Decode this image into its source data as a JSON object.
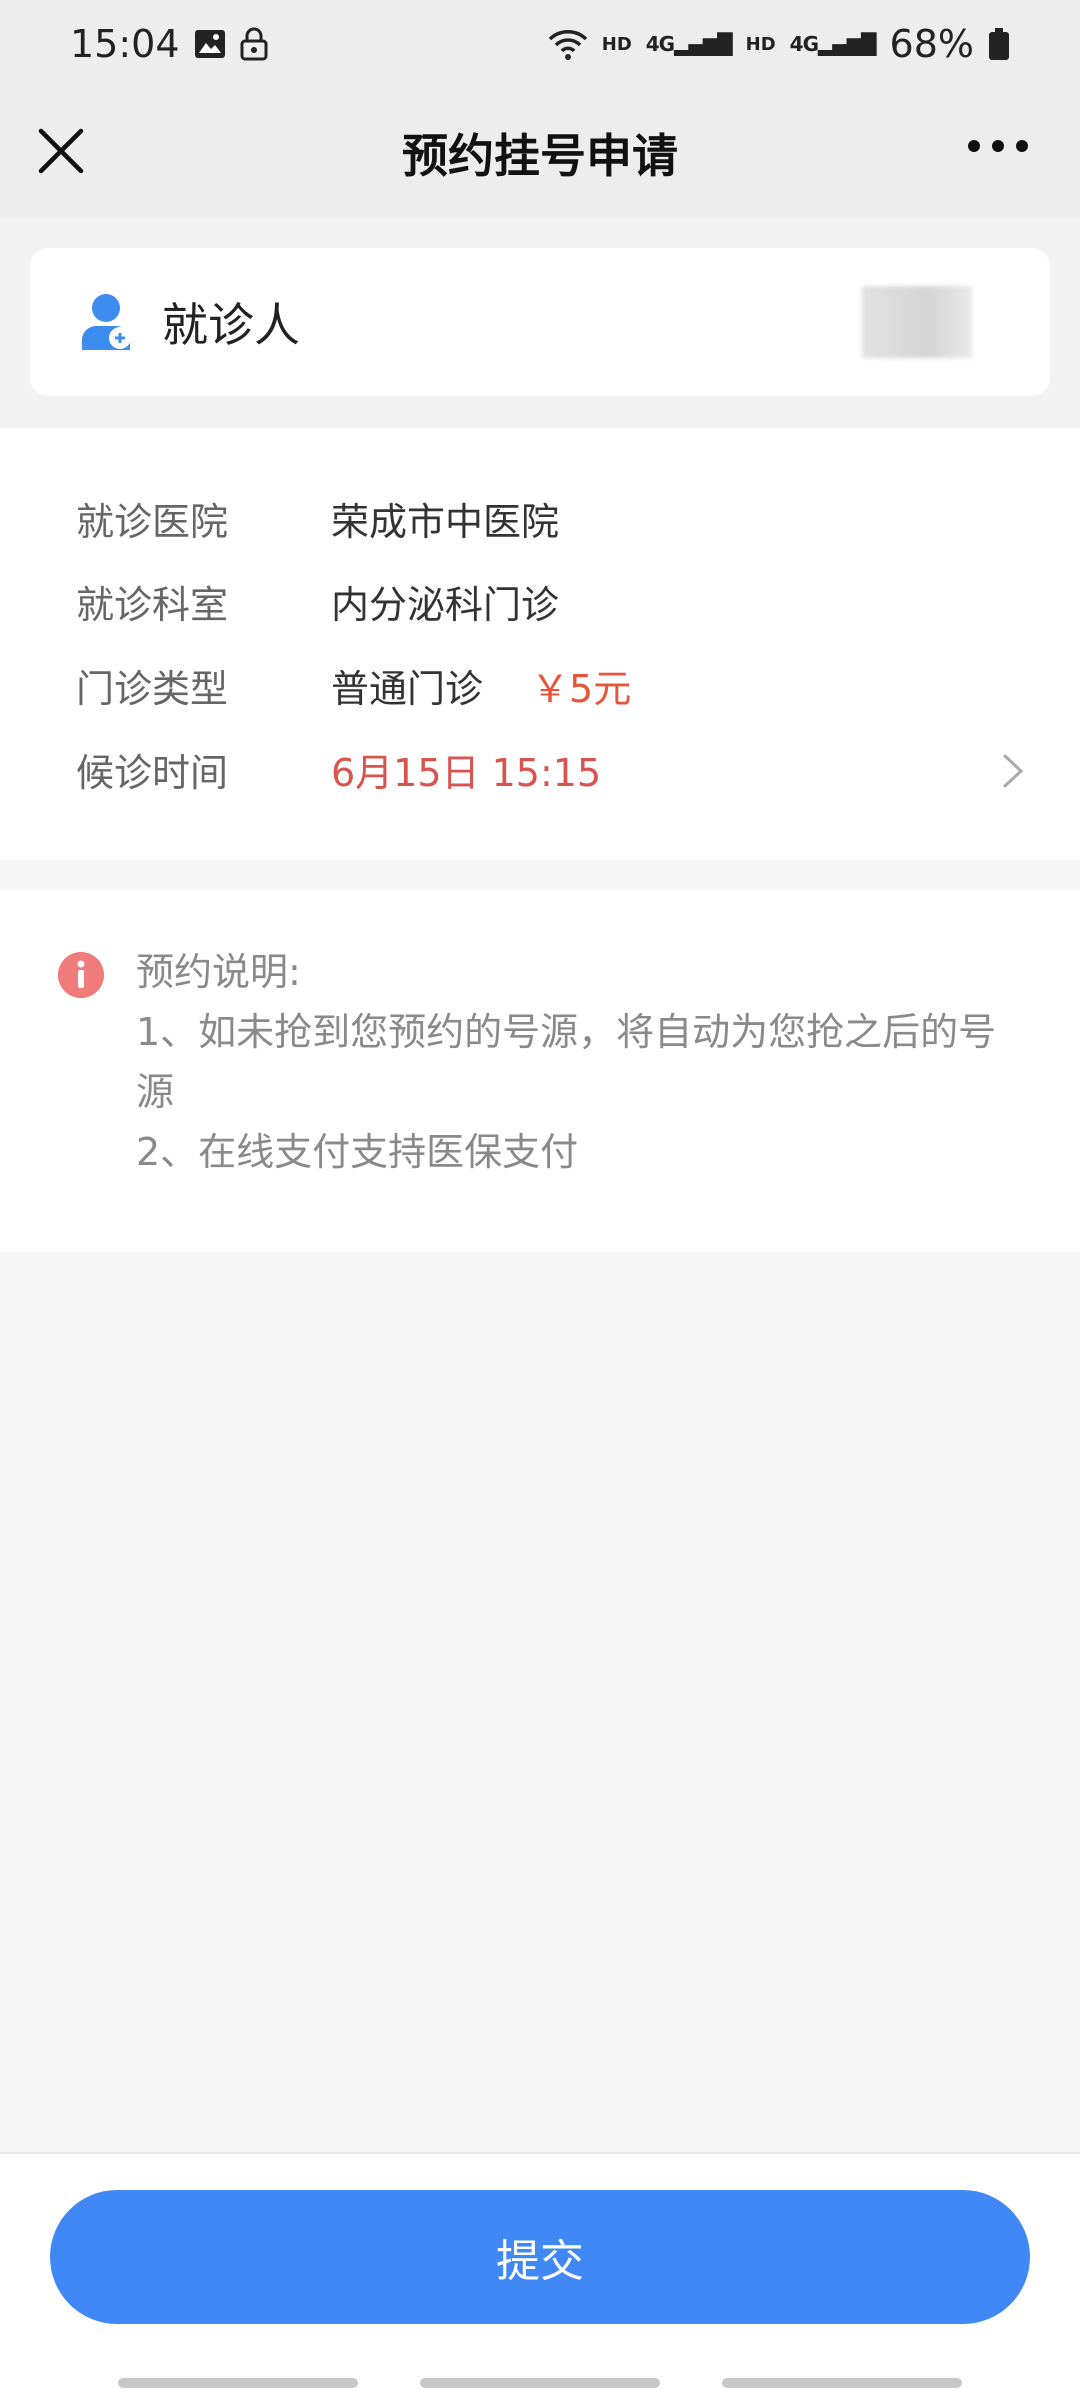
{
  "status_bar": {
    "time": "15:04",
    "network_hd1": "HD",
    "network_4g1": "4G",
    "network_hd2": "HD",
    "network_4g2": "4G",
    "battery": "68%"
  },
  "nav": {
    "title": "预约挂号申请"
  },
  "patient": {
    "label": "就诊人"
  },
  "info": {
    "rows": [
      {
        "label": "就诊医院",
        "value": "荣成市中医院"
      },
      {
        "label": "就诊科室",
        "value": "内分泌科门诊"
      },
      {
        "label": "门诊类型",
        "value": "普通门诊",
        "price": "￥5元"
      },
      {
        "label": "候诊时间",
        "value": "6月15日 15:15"
      }
    ]
  },
  "notice": {
    "title": "预约说明:",
    "line1": "1、如未抢到您预约的号源，将自动为您抢之后的号源",
    "line2": "2、在线支付支持医保支付"
  },
  "footer": {
    "submit_label": "提交"
  },
  "colors": {
    "accent": "#4088f5",
    "price": "#e8553a",
    "time": "#d9534f",
    "notice_icon": "#f07b7b"
  }
}
